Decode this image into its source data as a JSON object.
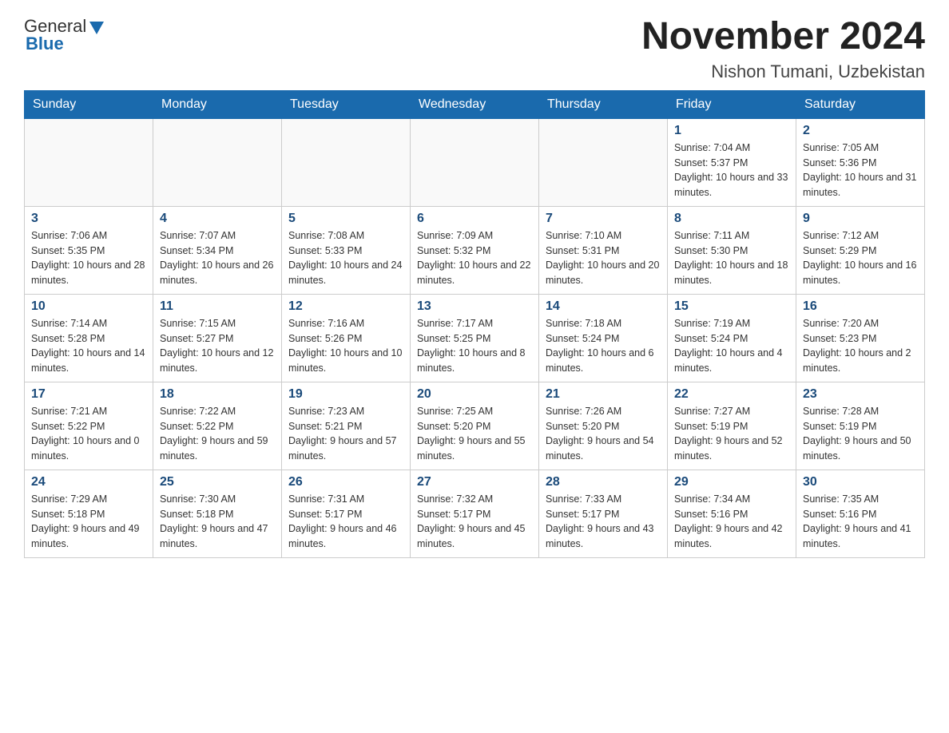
{
  "header": {
    "logo_text_general": "General",
    "logo_text_blue": "Blue",
    "month_title": "November 2024",
    "location": "Nishon Tumani, Uzbekistan"
  },
  "days_of_week": [
    "Sunday",
    "Monday",
    "Tuesday",
    "Wednesday",
    "Thursday",
    "Friday",
    "Saturday"
  ],
  "weeks": [
    [
      {
        "day": "",
        "sunrise": "",
        "sunset": "",
        "daylight": ""
      },
      {
        "day": "",
        "sunrise": "",
        "sunset": "",
        "daylight": ""
      },
      {
        "day": "",
        "sunrise": "",
        "sunset": "",
        "daylight": ""
      },
      {
        "day": "",
        "sunrise": "",
        "sunset": "",
        "daylight": ""
      },
      {
        "day": "",
        "sunrise": "",
        "sunset": "",
        "daylight": ""
      },
      {
        "day": "1",
        "sunrise": "Sunrise: 7:04 AM",
        "sunset": "Sunset: 5:37 PM",
        "daylight": "Daylight: 10 hours and 33 minutes."
      },
      {
        "day": "2",
        "sunrise": "Sunrise: 7:05 AM",
        "sunset": "Sunset: 5:36 PM",
        "daylight": "Daylight: 10 hours and 31 minutes."
      }
    ],
    [
      {
        "day": "3",
        "sunrise": "Sunrise: 7:06 AM",
        "sunset": "Sunset: 5:35 PM",
        "daylight": "Daylight: 10 hours and 28 minutes."
      },
      {
        "day": "4",
        "sunrise": "Sunrise: 7:07 AM",
        "sunset": "Sunset: 5:34 PM",
        "daylight": "Daylight: 10 hours and 26 minutes."
      },
      {
        "day": "5",
        "sunrise": "Sunrise: 7:08 AM",
        "sunset": "Sunset: 5:33 PM",
        "daylight": "Daylight: 10 hours and 24 minutes."
      },
      {
        "day": "6",
        "sunrise": "Sunrise: 7:09 AM",
        "sunset": "Sunset: 5:32 PM",
        "daylight": "Daylight: 10 hours and 22 minutes."
      },
      {
        "day": "7",
        "sunrise": "Sunrise: 7:10 AM",
        "sunset": "Sunset: 5:31 PM",
        "daylight": "Daylight: 10 hours and 20 minutes."
      },
      {
        "day": "8",
        "sunrise": "Sunrise: 7:11 AM",
        "sunset": "Sunset: 5:30 PM",
        "daylight": "Daylight: 10 hours and 18 minutes."
      },
      {
        "day": "9",
        "sunrise": "Sunrise: 7:12 AM",
        "sunset": "Sunset: 5:29 PM",
        "daylight": "Daylight: 10 hours and 16 minutes."
      }
    ],
    [
      {
        "day": "10",
        "sunrise": "Sunrise: 7:14 AM",
        "sunset": "Sunset: 5:28 PM",
        "daylight": "Daylight: 10 hours and 14 minutes."
      },
      {
        "day": "11",
        "sunrise": "Sunrise: 7:15 AM",
        "sunset": "Sunset: 5:27 PM",
        "daylight": "Daylight: 10 hours and 12 minutes."
      },
      {
        "day": "12",
        "sunrise": "Sunrise: 7:16 AM",
        "sunset": "Sunset: 5:26 PM",
        "daylight": "Daylight: 10 hours and 10 minutes."
      },
      {
        "day": "13",
        "sunrise": "Sunrise: 7:17 AM",
        "sunset": "Sunset: 5:25 PM",
        "daylight": "Daylight: 10 hours and 8 minutes."
      },
      {
        "day": "14",
        "sunrise": "Sunrise: 7:18 AM",
        "sunset": "Sunset: 5:24 PM",
        "daylight": "Daylight: 10 hours and 6 minutes."
      },
      {
        "day": "15",
        "sunrise": "Sunrise: 7:19 AM",
        "sunset": "Sunset: 5:24 PM",
        "daylight": "Daylight: 10 hours and 4 minutes."
      },
      {
        "day": "16",
        "sunrise": "Sunrise: 7:20 AM",
        "sunset": "Sunset: 5:23 PM",
        "daylight": "Daylight: 10 hours and 2 minutes."
      }
    ],
    [
      {
        "day": "17",
        "sunrise": "Sunrise: 7:21 AM",
        "sunset": "Sunset: 5:22 PM",
        "daylight": "Daylight: 10 hours and 0 minutes."
      },
      {
        "day": "18",
        "sunrise": "Sunrise: 7:22 AM",
        "sunset": "Sunset: 5:22 PM",
        "daylight": "Daylight: 9 hours and 59 minutes."
      },
      {
        "day": "19",
        "sunrise": "Sunrise: 7:23 AM",
        "sunset": "Sunset: 5:21 PM",
        "daylight": "Daylight: 9 hours and 57 minutes."
      },
      {
        "day": "20",
        "sunrise": "Sunrise: 7:25 AM",
        "sunset": "Sunset: 5:20 PM",
        "daylight": "Daylight: 9 hours and 55 minutes."
      },
      {
        "day": "21",
        "sunrise": "Sunrise: 7:26 AM",
        "sunset": "Sunset: 5:20 PM",
        "daylight": "Daylight: 9 hours and 54 minutes."
      },
      {
        "day": "22",
        "sunrise": "Sunrise: 7:27 AM",
        "sunset": "Sunset: 5:19 PM",
        "daylight": "Daylight: 9 hours and 52 minutes."
      },
      {
        "day": "23",
        "sunrise": "Sunrise: 7:28 AM",
        "sunset": "Sunset: 5:19 PM",
        "daylight": "Daylight: 9 hours and 50 minutes."
      }
    ],
    [
      {
        "day": "24",
        "sunrise": "Sunrise: 7:29 AM",
        "sunset": "Sunset: 5:18 PM",
        "daylight": "Daylight: 9 hours and 49 minutes."
      },
      {
        "day": "25",
        "sunrise": "Sunrise: 7:30 AM",
        "sunset": "Sunset: 5:18 PM",
        "daylight": "Daylight: 9 hours and 47 minutes."
      },
      {
        "day": "26",
        "sunrise": "Sunrise: 7:31 AM",
        "sunset": "Sunset: 5:17 PM",
        "daylight": "Daylight: 9 hours and 46 minutes."
      },
      {
        "day": "27",
        "sunrise": "Sunrise: 7:32 AM",
        "sunset": "Sunset: 5:17 PM",
        "daylight": "Daylight: 9 hours and 45 minutes."
      },
      {
        "day": "28",
        "sunrise": "Sunrise: 7:33 AM",
        "sunset": "Sunset: 5:17 PM",
        "daylight": "Daylight: 9 hours and 43 minutes."
      },
      {
        "day": "29",
        "sunrise": "Sunrise: 7:34 AM",
        "sunset": "Sunset: 5:16 PM",
        "daylight": "Daylight: 9 hours and 42 minutes."
      },
      {
        "day": "30",
        "sunrise": "Sunrise: 7:35 AM",
        "sunset": "Sunset: 5:16 PM",
        "daylight": "Daylight: 9 hours and 41 minutes."
      }
    ]
  ]
}
